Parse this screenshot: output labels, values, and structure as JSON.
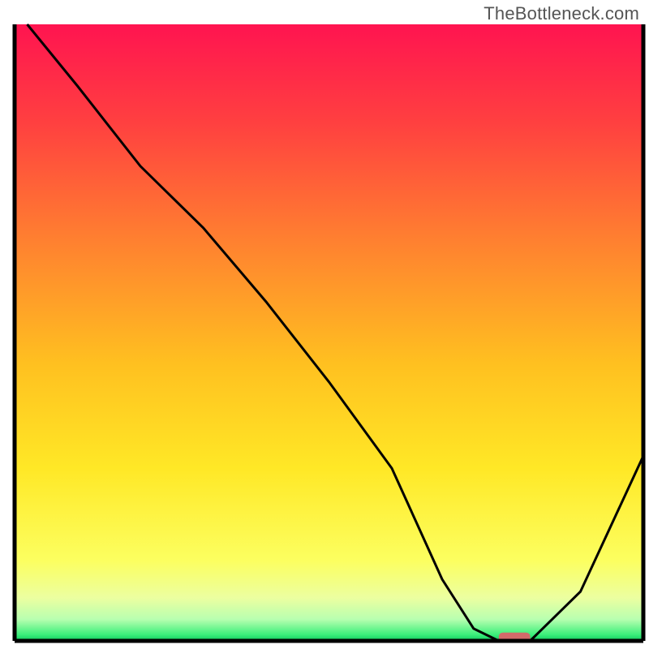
{
  "watermark": "TheBottleneck.com",
  "chart_data": {
    "type": "line",
    "title": "",
    "xlabel": "",
    "ylabel": "",
    "xlim": [
      0,
      100
    ],
    "ylim": [
      0,
      100
    ],
    "series": [
      {
        "name": "curve",
        "x": [
          2,
          10,
          20,
          30,
          40,
          50,
          60,
          68,
          73,
          77,
          82,
          90,
          100
        ],
        "y": [
          100,
          90,
          77,
          67,
          55,
          42,
          28,
          10,
          2,
          0,
          0,
          8,
          30
        ]
      }
    ],
    "marker": {
      "x_center": 79.5,
      "y": 0,
      "width": 5,
      "height": 1.5,
      "color": "#d36a6a"
    },
    "axis_color": "#000000",
    "background_gradient_stops": [
      {
        "offset": 0.0,
        "color": "#ff1450"
      },
      {
        "offset": 0.16,
        "color": "#ff4040"
      },
      {
        "offset": 0.35,
        "color": "#ff8030"
      },
      {
        "offset": 0.55,
        "color": "#ffc020"
      },
      {
        "offset": 0.72,
        "color": "#ffe826"
      },
      {
        "offset": 0.87,
        "color": "#fcff60"
      },
      {
        "offset": 0.93,
        "color": "#ecffa0"
      },
      {
        "offset": 0.965,
        "color": "#b8ffb0"
      },
      {
        "offset": 0.99,
        "color": "#3bef7a"
      },
      {
        "offset": 0.996,
        "color": "#20d868"
      },
      {
        "offset": 1.0,
        "color": "#14c85c"
      }
    ]
  }
}
